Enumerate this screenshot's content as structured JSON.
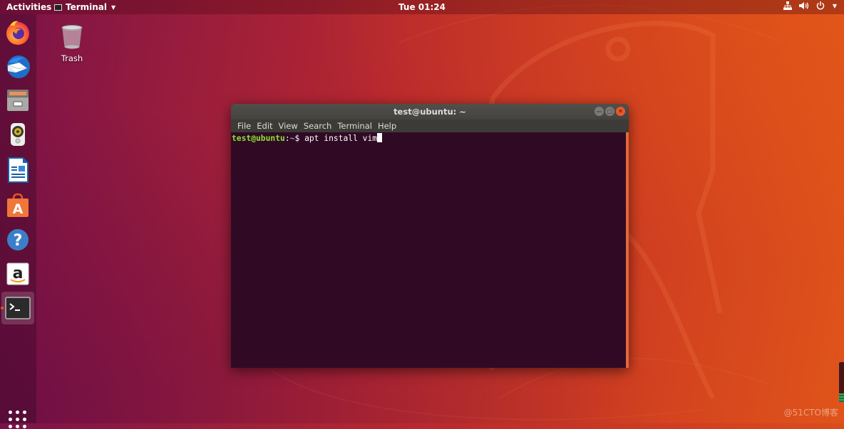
{
  "topbar": {
    "activities_label": "Activities",
    "app_menu_label": "Terminal",
    "clock": "Tue 01:24",
    "tray": [
      "network-icon",
      "volume-icon",
      "power-icon",
      "system-menu-caret"
    ]
  },
  "dock": {
    "items": [
      {
        "name": "Firefox Web Browser",
        "icon": "firefox-icon"
      },
      {
        "name": "Thunderbird Mail",
        "icon": "thunderbird-icon"
      },
      {
        "name": "Files",
        "icon": "files-icon"
      },
      {
        "name": "Rhythmbox",
        "icon": "rhythmbox-icon"
      },
      {
        "name": "LibreOffice Writer",
        "icon": "libreoffice-writer-icon"
      },
      {
        "name": "Ubuntu Software",
        "icon": "ubuntu-software-icon"
      },
      {
        "name": "Help",
        "icon": "help-icon"
      },
      {
        "name": "Amazon",
        "icon": "amazon-icon"
      },
      {
        "name": "Terminal",
        "icon": "terminal-icon",
        "active": true
      }
    ],
    "show_apps": "show-applications-icon"
  },
  "desktop": {
    "icons": [
      {
        "label": "Trash",
        "icon": "trash-icon"
      }
    ]
  },
  "terminal": {
    "title": "test@ubuntu: ~",
    "menu": [
      "File",
      "Edit",
      "View",
      "Search",
      "Terminal",
      "Help"
    ],
    "prompt_user": "test@ubuntu",
    "prompt_sep": ":",
    "prompt_path": "~",
    "prompt_symbol": "$ ",
    "command": "apt install vim"
  },
  "colors": {
    "accent": "#e95420",
    "terminal_bg": "#300a24",
    "prompt_user": "#8ae234",
    "prompt_path": "#729fcf"
  },
  "side_widget": {
    "level": 0.22
  },
  "watermark": "@51CTO博客"
}
